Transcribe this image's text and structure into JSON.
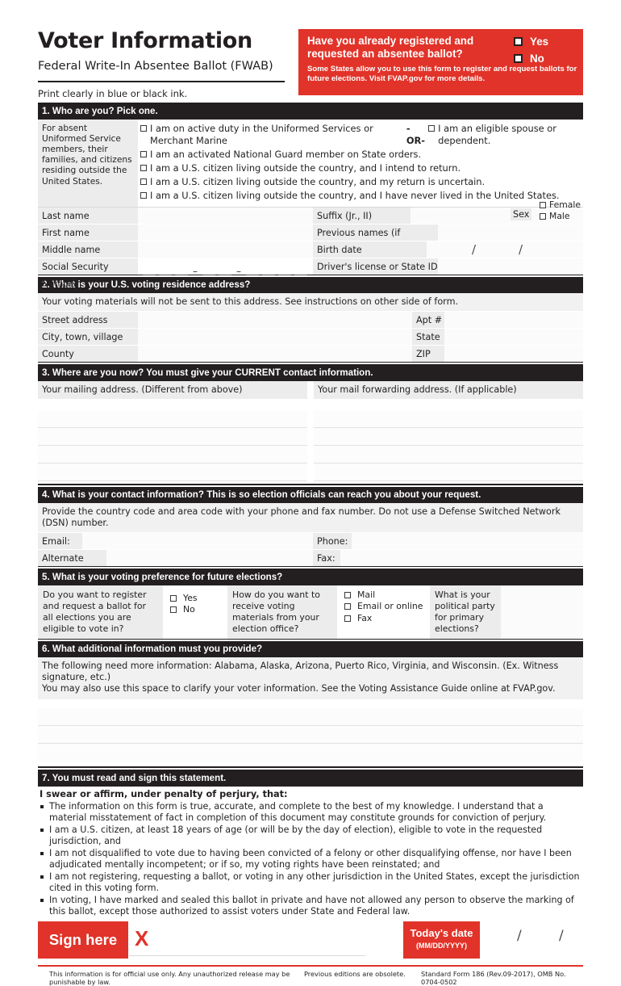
{
  "header": {
    "title": "Voter Information",
    "subtitle": "Federal Write-In Absentee Ballot (FWAB)",
    "print_note": "Print clearly in blue or black ink."
  },
  "registered_box": {
    "question": "Have you already registered and requested an absentee ballot?",
    "subtext": "Some States allow you to use this form to register and request ballots for future elections. Visit FVAP.gov for more details.",
    "yes_label": "Yes",
    "no_label": "No",
    "accent_color": "#e13329"
  },
  "section1": {
    "heading": "1. Who are you? Pick one.",
    "side_note": "For absent Uniformed Service members, their families, and citizens residing outside the United States.",
    "options": [
      {
        "text": "I am on active duty in the Uniformed Services or Merchant Marine",
        "or": "-OR-",
        "text2": "I am an eligible spouse or dependent."
      },
      {
        "text": "I am an activated National Guard member on State orders."
      },
      {
        "text": "I am a U.S. citizen living outside the country, and I intend to return."
      },
      {
        "text": "I am a U.S. citizen living outside the country, and my return is uncertain."
      },
      {
        "text": "I am a U.S. citizen living outside the country, and I have never lived in the United States."
      }
    ],
    "fields": {
      "last_name": "Last name",
      "suffix": "Suffix (Jr., II)",
      "sex": "Sex",
      "female": "Female",
      "male": "Male",
      "first_name": "First name",
      "previous_names": "Previous names (if applicable)",
      "middle_name": "Middle name",
      "birth_date": "Birth date (MM/DD/YYYY)",
      "ssn": "Social Security Number",
      "drivers_license": "Driver's license or State ID #"
    }
  },
  "section2": {
    "heading": "2. What is your U.S. voting residence address?",
    "note": "Your voting materials will not be sent to this address. See instructions on other side of form.",
    "rows": [
      {
        "left": "Street address",
        "right": "Apt #"
      },
      {
        "left": "City, town, village",
        "right": "State"
      },
      {
        "left": "County",
        "right": "ZIP"
      }
    ]
  },
  "section3": {
    "heading": "3. Where are you now? You must give your CURRENT contact information.",
    "mailing_label": "Your mailing address. (Different from above)",
    "forwarding_label": "Your mail forwarding address. (If applicable)",
    "line_count": 4
  },
  "section4": {
    "heading": "4. What is your contact information? This is so election officials can reach you about your request.",
    "note": "Provide the country code and area code with your phone and fax number. Do not use a Defense Switched Network (DSN) number.",
    "rows": [
      {
        "left": "Email:",
        "right": "Phone:"
      },
      {
        "left": "Alternate email:",
        "right": "Fax:"
      }
    ]
  },
  "section5": {
    "heading": "5. What is your voting preference for future elections?",
    "q1": "Do you want to register and request a ballot for all elections you are eligible to vote in?",
    "q1_options": [
      "Yes",
      "No"
    ],
    "q2": "How do you want to receive voting materials from your election office?",
    "q2_options": [
      "Mail",
      "Email or online",
      "Fax"
    ],
    "q3": "What is your political party for primary elections?"
  },
  "section6": {
    "heading": "6. What additional information must you provide?",
    "note_line1": "The following need more information: Alabama, Alaska, Arizona, Puerto Rico, Virginia, and Wisconsin. (Ex. Witness signature, etc.)",
    "note_line2": "You may also use this space to clarify your voter information. See the Voting Assistance Guide online at FVAP.gov.",
    "line_count": 3
  },
  "section7": {
    "heading": "7. You must read and sign this statement.",
    "swear": "I swear or affirm, under penalty of perjury, that:",
    "bullets": [
      "The information on this form is true, accurate, and complete to the best of my knowledge. I understand that a material misstatement of fact in completion of this document may constitute grounds for conviction of perjury.",
      "I am a U.S. citizen, at least 18 years of age (or will be by the day of election), eligible to vote in the requested jurisdiction, and",
      "I am not disqualified to vote due to having been convicted of a felony or other disqualifying offense, nor have I been adjudicated mentally incompetent; or if so, my voting rights have been reinstated; and",
      "I am not registering, requesting a ballot, or voting in any other jurisdiction in the United States, except the jurisdiction cited in this voting form.",
      "In voting, I have marked and sealed this ballot in private and have not allowed any person to observe the marking of this ballot, except those authorized to assist voters under State and Federal law."
    ],
    "sign_here": "Sign here",
    "x_mark": "X",
    "todays_date": "Today's date",
    "date_format": "(MM/DD/YYYY)",
    "slash": "/"
  },
  "footer": {
    "left": "This information is for official use only. Any unauthorized release may be punishable by law.",
    "middle": "Previous editions are obsolete.",
    "right": "Standard Form 186 (Rev.09-2017), OMB No. 0704-0502"
  }
}
